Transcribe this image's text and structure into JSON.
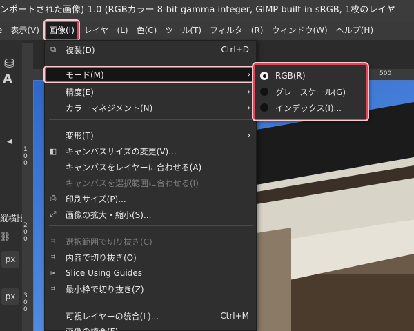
{
  "window": {
    "title": "ンポートされた画像)-1.0 (RGBカラー 8-bit gamma integer, GIMP built-in sRGB, 1枚のレイヤ"
  },
  "menubar": {
    "items": [
      {
        "label": "表示(V)"
      },
      {
        "label": "画像(I)"
      },
      {
        "label": "レイヤー(L)"
      },
      {
        "label": "色(C)"
      },
      {
        "label": "ツール(T)"
      },
      {
        "label": "フィルター(R)"
      },
      {
        "label": "ウィンドウ(W)"
      },
      {
        "label": "ヘルプ(H)"
      }
    ],
    "partial_first": "e"
  },
  "toolbox": {
    "text_tool": "A",
    "tab_label": "縦横比",
    "unit_1": "px",
    "unit_2": "px"
  },
  "ruler": {
    "h_mark": "500",
    "v_marks": [
      "100",
      "200",
      "300"
    ]
  },
  "image_menu": {
    "items": [
      {
        "label": "複製(D)",
        "shortcut": "Ctrl+D"
      },
      {
        "label": "モード(M)"
      },
      {
        "label": "精度(E)"
      },
      {
        "label": "カラーマネジメント(N)"
      },
      {
        "label": "変形(T)"
      },
      {
        "label": "キャンバスサイズの変更(V)..."
      },
      {
        "label": "キャンバスをレイヤーに合わせる(A)"
      },
      {
        "label": "キャンバスを選択範囲に合わせる(I)"
      },
      {
        "label": "印刷サイズ(P)..."
      },
      {
        "label": "画像の拡大・縮小(S)..."
      },
      {
        "label": "選択範囲で切り抜き(C)"
      },
      {
        "label": "内容で切り抜き(O)"
      },
      {
        "label": "Slice Using Guides"
      },
      {
        "label": "最小枠で切り抜き(Z)"
      },
      {
        "label": "可視レイヤーの統合(L)...",
        "shortcut": "Ctrl+M"
      },
      {
        "label": "画像の統合(F)"
      }
    ]
  },
  "mode_submenu": {
    "items": [
      {
        "label": "RGB(R)",
        "selected": true
      },
      {
        "label": "グレースケール(G)",
        "selected": false
      },
      {
        "label": "インデックス(I)...",
        "selected": false
      }
    ]
  },
  "colors": {
    "highlight_outline": "#e0475b",
    "menu_bg": "#2f2f2f",
    "sky": "#4b86dd"
  }
}
